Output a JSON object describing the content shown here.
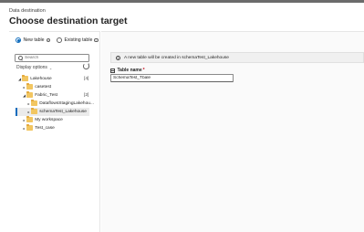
{
  "header": {
    "subtitle": "Data destination",
    "title": "Choose destination target"
  },
  "target_options": [
    {
      "label": "New table",
      "selected": true
    },
    {
      "label": "Existing table",
      "selected": false
    }
  ],
  "search": {
    "placeholder": "Search",
    "value": ""
  },
  "display_options": {
    "label": "Display options"
  },
  "tree": {
    "items": [
      {
        "label": "Lakehouse",
        "count": "[4]",
        "expanded": true
      },
      {
        "label": "casetest",
        "expanded": false
      },
      {
        "label": "Fabric_Test",
        "count": "[2]",
        "expanded": true
      },
      {
        "label": "DataflowsStagingLakehou...",
        "expanded": false
      },
      {
        "label": "schemaTest_Lakehouse",
        "expanded": false,
        "selected": true
      },
      {
        "label": "My workspace",
        "expanded": false
      },
      {
        "label": "Test_case",
        "expanded": false
      }
    ]
  },
  "notice": {
    "text": "A new table will be created in schemaTest_Lakehouse",
    "icon": "info-icon"
  },
  "table_name": {
    "label": "Table name",
    "required_marker": "*",
    "value": "SchemaTest_Tbale"
  },
  "colors": {
    "accent": "#0f6cbd",
    "folder": "#f2c661"
  }
}
